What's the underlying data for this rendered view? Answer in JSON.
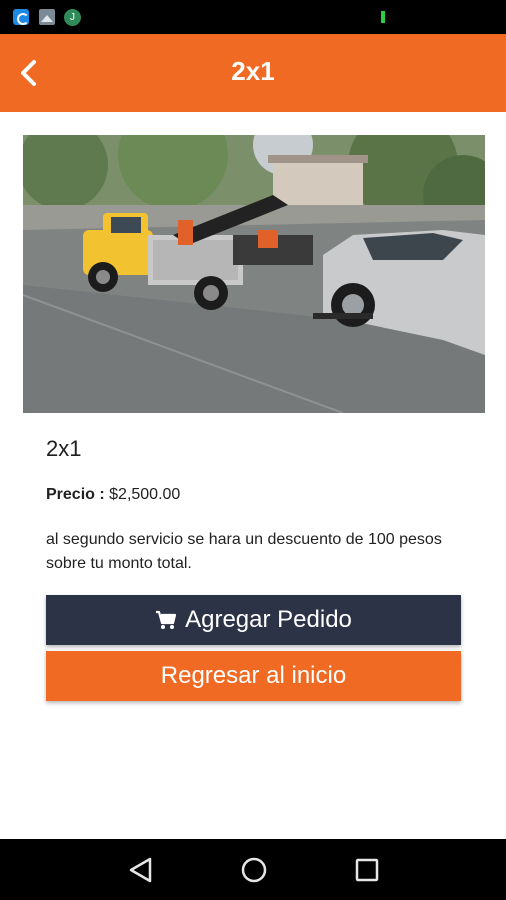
{
  "status_bar": {
    "icons": [
      "wallet-app-icon",
      "image-icon",
      "j-app-icon"
    ],
    "j_letter": "J"
  },
  "app_bar": {
    "title": "2x1",
    "back_icon": "chevron-left-icon"
  },
  "product": {
    "name": "2x1",
    "price_label": "Precio :",
    "price_value": "$2,500.00",
    "description": "al segundo servicio se hara un descuento de 100 pesos sobre tu monto total."
  },
  "actions": {
    "add_order_label": "Agregar Pedido",
    "add_order_icon": "shopping-cart-icon",
    "back_home_label": "Regresar al inicio"
  },
  "nav_bar": {
    "icons": [
      "back-triangle-icon",
      "home-circle-icon",
      "recents-square-icon"
    ]
  },
  "colors": {
    "accent": "#f06a23",
    "primary_button": "#2c3346",
    "text": "#222222"
  }
}
